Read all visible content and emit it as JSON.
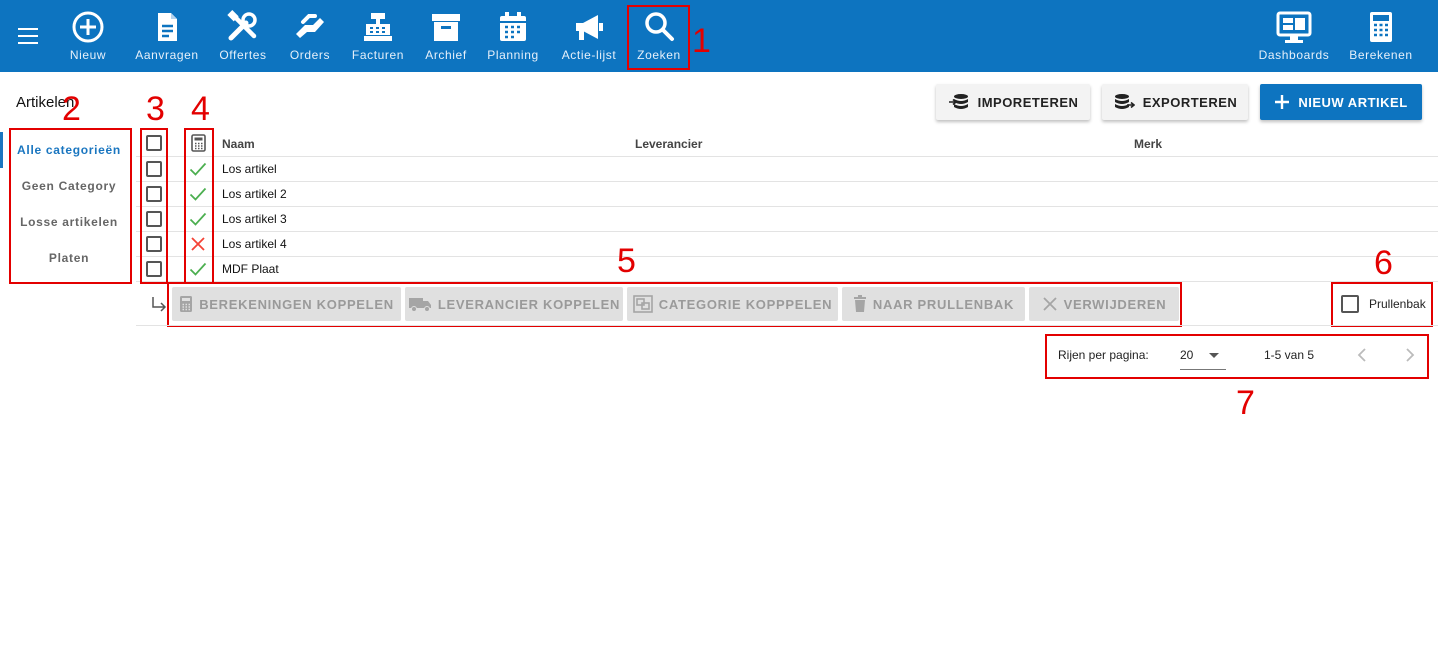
{
  "nav": {
    "items": [
      {
        "label": "Nieuw",
        "icon": "plus-circle-icon"
      },
      {
        "label": "Aanvragen",
        "icon": "document-icon"
      },
      {
        "label": "Offertes",
        "icon": "tools-icon"
      },
      {
        "label": "Orders",
        "icon": "handshake-icon"
      },
      {
        "label": "Facturen",
        "icon": "cash-register-icon"
      },
      {
        "label": "Archief",
        "icon": "archive-icon"
      },
      {
        "label": "Planning",
        "icon": "calendar-icon"
      },
      {
        "label": "Actie-lijst",
        "icon": "megaphone-icon"
      },
      {
        "label": "Zoeken",
        "icon": "search-icon"
      }
    ],
    "right_items": [
      {
        "label": "Dashboards",
        "icon": "dashboard-icon"
      },
      {
        "label": "Berekenen",
        "icon": "calculator-icon"
      }
    ]
  },
  "annotations": [
    "1",
    "2",
    "3",
    "4",
    "5",
    "6",
    "7"
  ],
  "page": {
    "title": "Artikelen"
  },
  "sidebar": {
    "items": [
      {
        "label": "Alle categorieën",
        "active": true
      },
      {
        "label": "Geen Category",
        "active": false
      },
      {
        "label": "Losse artikelen",
        "active": false
      },
      {
        "label": "Platen",
        "active": false
      }
    ]
  },
  "toolbar": {
    "import_label": "IMPORETEREN",
    "export_label": "EXPORTEREN",
    "new_label": "NIEUW ARTIKEL"
  },
  "table": {
    "columns": [
      "Naam",
      "Leverancier",
      "Merk"
    ],
    "rows": [
      {
        "name": "Los artikel",
        "calc": true
      },
      {
        "name": "Los artikel 2",
        "calc": true
      },
      {
        "name": "Los artikel 3",
        "calc": true
      },
      {
        "name": "Los artikel 4",
        "calc": false
      },
      {
        "name": "MDF Plaat",
        "calc": true
      }
    ]
  },
  "actions": {
    "link_calc": "BEREKENINGEN KOPPELEN",
    "link_supplier": "LEVERANCIER KOPPELEN",
    "link_category": "CATEGORIE KOPPPELEN",
    "to_trash": "NAAR PRULLENBAK",
    "delete": "VERWIJDEREN"
  },
  "trash": {
    "label": "Prullenbak"
  },
  "pagination": {
    "rows_label": "Rijen per pagina:",
    "rows_value": "20",
    "range": "1-5 van 5"
  },
  "colors": {
    "primary": "#0d74c0",
    "success": "#4caf50",
    "error": "#f44336",
    "annotation": "#e30000"
  }
}
